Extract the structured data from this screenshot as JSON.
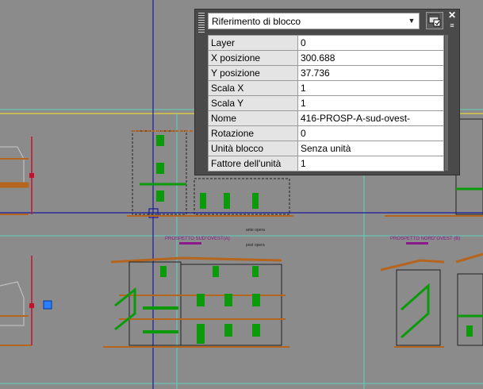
{
  "palette": {
    "object_type": "Riferimento di blocco",
    "properties": [
      {
        "label": "Layer",
        "value": "0"
      },
      {
        "label": "X posizione",
        "value": "300.688"
      },
      {
        "label": "Y posizione",
        "value": "37.736"
      },
      {
        "label": "Scala X",
        "value": "1"
      },
      {
        "label": "Scala Y",
        "value": "1"
      },
      {
        "label": "Nome",
        "value": "416-PROSP-A-sud-ovest-"
      },
      {
        "label": "Rotazione",
        "value": "0"
      },
      {
        "label": "Unità blocco",
        "value": "Senza unità"
      },
      {
        "label": "Fattore dell'unità",
        "value": "1"
      }
    ]
  },
  "drawing": {
    "title_left": "PROSPETTO SUD\"OVEST(A)",
    "title_right": "PROSPETTO NORD\"OVEST (B)",
    "ante_label": "ante opera",
    "post_label": "post opera"
  },
  "colors": {
    "background": "#8b8b8b",
    "palette_bg": "#4a4a4a",
    "crosshair": "#1a1a9a",
    "yellow_line": "#d7c84a",
    "cyan_line": "#5fd1b8",
    "window_green": "#0a9a0a",
    "roof_brown": "#b5651d",
    "title_magenta": "#8a1a8a"
  }
}
